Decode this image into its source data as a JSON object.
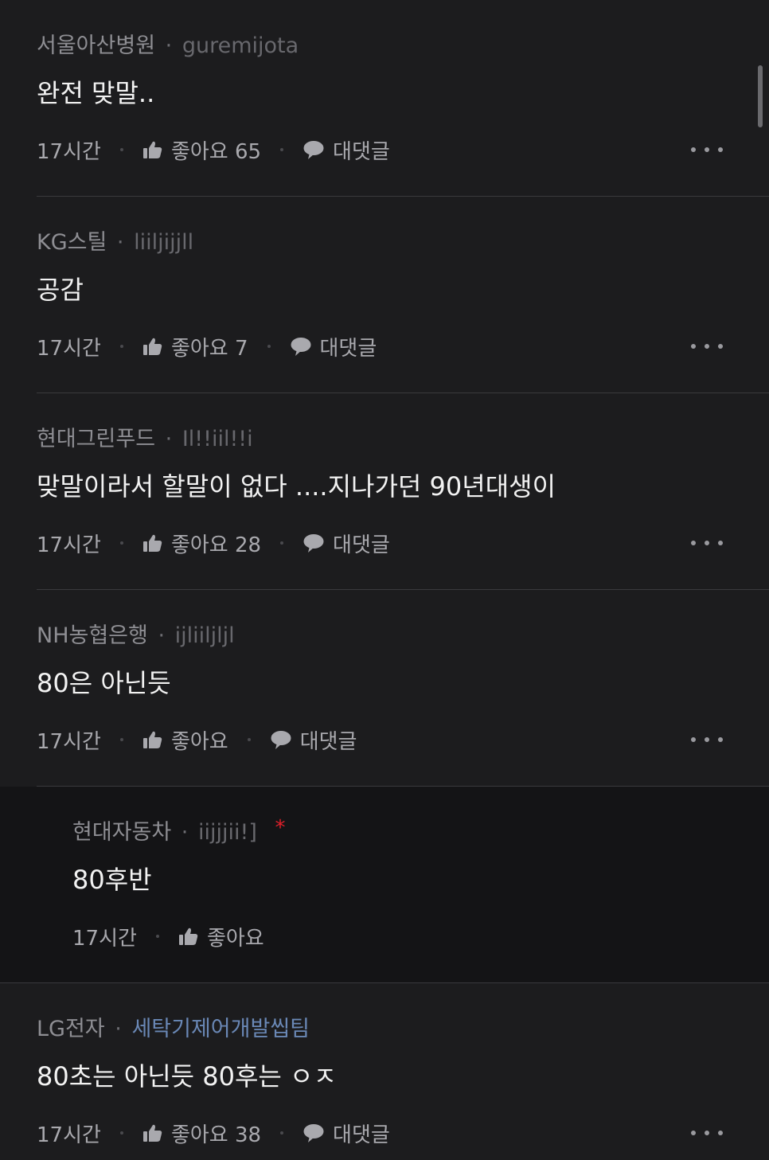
{
  "comments": [
    {
      "company": "서울아산병원",
      "separator": "·",
      "nickname": "guremijota",
      "text": "완전 맞말..",
      "time": "17시간",
      "like_label": "좋아요 65",
      "reply_label": "대댓글"
    },
    {
      "company": "KG스틸",
      "separator": "·",
      "nickname": "liiljijjll",
      "text": "공감",
      "time": "17시간",
      "like_label": "좋아요 7",
      "reply_label": "대댓글"
    },
    {
      "company": "현대그린푸드",
      "separator": "·",
      "nickname": "Il!!iil!!i",
      "text": "맞말이라서 할말이 없다 ....지나가던 90년대생이",
      "time": "17시간",
      "like_label": "좋아요 28",
      "reply_label": "대댓글"
    },
    {
      "company": "NH농협은행",
      "separator": "·",
      "nickname": "ijliiljljl",
      "text": "80은 아닌듯",
      "time": "17시간",
      "like_label": "좋아요",
      "reply_label": "대댓글"
    },
    {
      "company": "현대자동차",
      "separator": "·",
      "nickname": "iijjjii!]",
      "op_mark": "*",
      "text": "80후반",
      "time": "17시간",
      "like_label": "좋아요"
    },
    {
      "company": "LG전자",
      "separator": "·",
      "nickname": "세탁기제어개발씹팀",
      "text": "80초는 아닌듯 80후는 ㅇㅈ",
      "time": "17시간",
      "like_label": "좋아요 38",
      "reply_label": "대댓글"
    }
  ],
  "colors": {
    "background": "#1c1c1e",
    "reply_background": "#141416",
    "text": "#f2f2f2",
    "muted": "#a9a9ae",
    "op_star": "#e0202a",
    "link_nickname": "#6a88b6"
  },
  "icons": {
    "like": "thumbs-up-icon",
    "reply": "speech-bubble-icon",
    "more": "more-dots-icon"
  }
}
